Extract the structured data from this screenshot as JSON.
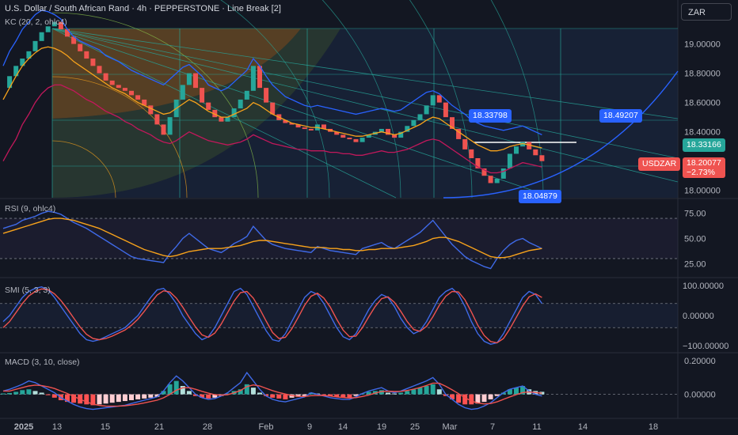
{
  "header": {
    "title": "U.S. Dollar / South African Rand · 4h · PEPPERSTONE · Line Break [2]",
    "kc_label": "KC (20, 2, ohlc4)",
    "currency_button": "ZAR"
  },
  "indicators": {
    "rsi_label": "RSI (9, ohlc4)",
    "smi_label": "SMI (5, 3, 3)",
    "macd_label": "MACD (3, 10, close)"
  },
  "price_tags": {
    "upper_channel": "18.49207",
    "green_level": "18.33166",
    "symbol": "USDZAR",
    "last_price": "18.20077",
    "change": "−2.73%",
    "box_upper": "18.33798",
    "box_lower": "18.04879"
  },
  "colors": {
    "background": "#131722",
    "up": "#26a69a",
    "down": "#ef5350",
    "kc_upper": "#2962ff",
    "kc_basis": "#f7a21b",
    "kc_lower": "#c2185b",
    "rsi": "#3f6ae8",
    "rsi_ma": "#f7a21b",
    "smi": "#3f6ae8",
    "smi_signal": "#ef5350",
    "macd": "#3f6ae8",
    "macd_signal": "#ef5350"
  },
  "chart_data": [
    {
      "type": "line",
      "pane": "price",
      "ylim": [
        17.95,
        19.3
      ],
      "y_ticks": [
        19.0,
        18.8,
        18.6,
        18.4,
        18.0
      ],
      "y_tick_labels": [
        "19.00000",
        "18.80000",
        "18.60000",
        "18.40000",
        "18.00000"
      ],
      "x_ticks": [
        "2025",
        "13",
        "15",
        "21",
        "28",
        "Feb",
        "9",
        "14",
        "19",
        "25",
        "Mar",
        "7",
        "11",
        "14",
        "18"
      ],
      "grid": true,
      "series": [
        {
          "role": "price",
          "values": [
            18.7,
            18.78,
            18.85,
            18.9,
            18.95,
            19.02,
            19.08,
            19.12,
            19.15,
            19.1,
            19.05,
            19.0,
            18.95,
            18.9,
            18.85,
            18.8,
            18.75,
            18.72,
            18.7,
            18.68,
            18.65,
            18.62,
            18.58,
            18.52,
            18.45,
            18.38,
            18.5,
            18.62,
            18.72,
            18.8,
            18.7,
            18.6,
            18.55,
            18.5,
            18.47,
            18.5,
            18.56,
            18.62,
            18.68,
            18.85,
            18.7,
            18.6,
            18.52,
            18.48,
            18.46,
            18.45,
            18.43,
            18.42,
            18.41,
            18.45,
            18.42,
            18.4,
            18.38,
            18.36,
            18.35,
            18.33,
            18.36,
            18.38,
            18.4,
            18.42,
            18.38,
            18.36,
            18.4,
            18.44,
            18.48,
            18.52,
            18.58,
            18.65,
            18.6,
            18.5,
            18.42,
            18.35,
            18.28,
            18.22,
            18.15,
            18.1,
            18.05,
            18.08,
            18.15,
            18.25,
            18.3,
            18.33,
            18.28,
            18.24,
            18.2
          ]
        },
        {
          "role": "kc_upper",
          "values": [
            18.85,
            18.95,
            19.02,
            19.1,
            19.15,
            19.2,
            19.23,
            19.22,
            19.2,
            19.17,
            19.1,
            19.05,
            19.02,
            19.0,
            18.98,
            18.96,
            18.92,
            18.9,
            18.88,
            18.85,
            18.82,
            18.8,
            18.78,
            18.76,
            18.74,
            18.72,
            18.76,
            18.8,
            18.84,
            18.86,
            18.82,
            18.78,
            18.72,
            18.7,
            18.68,
            18.7,
            18.74,
            18.78,
            18.82,
            18.9,
            18.85,
            18.78,
            18.72,
            18.68,
            18.64,
            18.62,
            18.6,
            18.58,
            18.57,
            18.58,
            18.57,
            18.56,
            18.55,
            18.54,
            18.53,
            18.52,
            18.53,
            18.54,
            18.55,
            18.56,
            18.55,
            18.54,
            18.55,
            18.58,
            18.61,
            18.64,
            18.67,
            18.68,
            18.66,
            18.62,
            18.58,
            18.55,
            18.52,
            18.48,
            18.46,
            18.44,
            18.43,
            18.42,
            18.41,
            18.42,
            18.43,
            18.44,
            18.42,
            18.4,
            18.38
          ]
        },
        {
          "role": "kc_basis",
          "values": [
            18.62,
            18.7,
            18.78,
            18.85,
            18.9,
            18.94,
            18.97,
            18.98,
            18.97,
            18.95,
            18.92,
            18.88,
            18.85,
            18.82,
            18.79,
            18.76,
            18.73,
            18.7,
            18.68,
            18.66,
            18.63,
            18.6,
            18.58,
            18.56,
            18.54,
            18.52,
            18.53,
            18.56,
            18.59,
            18.62,
            18.6,
            18.57,
            18.54,
            18.52,
            18.5,
            18.5,
            18.52,
            18.54,
            18.56,
            18.6,
            18.58,
            18.55,
            18.52,
            18.5,
            18.48,
            18.46,
            18.45,
            18.44,
            18.43,
            18.43,
            18.42,
            18.41,
            18.4,
            18.39,
            18.38,
            18.37,
            18.37,
            18.38,
            18.39,
            18.4,
            18.39,
            18.38,
            18.39,
            18.41,
            18.43,
            18.45,
            18.48,
            18.5,
            18.49,
            18.46,
            18.43,
            18.4,
            18.37,
            18.34,
            18.31,
            18.29,
            18.27,
            18.27,
            18.28,
            18.3,
            18.31,
            18.32,
            18.31,
            18.3,
            18.29
          ]
        },
        {
          "role": "kc_lower",
          "values": [
            18.2,
            18.28,
            18.35,
            18.45,
            18.52,
            18.6,
            18.66,
            18.7,
            18.72,
            18.72,
            18.7,
            18.68,
            18.65,
            18.62,
            18.6,
            18.57,
            18.54,
            18.52,
            18.5,
            18.47,
            18.45,
            18.42,
            18.4,
            18.38,
            18.35,
            18.33,
            18.32,
            18.34,
            18.37,
            18.4,
            18.38,
            18.36,
            18.34,
            18.33,
            18.32,
            18.31,
            18.32,
            18.33,
            18.35,
            18.38,
            18.36,
            18.34,
            18.32,
            18.31,
            18.3,
            18.29,
            18.28,
            18.28,
            18.27,
            18.27,
            18.27,
            18.26,
            18.26,
            18.25,
            18.25,
            18.24,
            18.24,
            18.25,
            18.26,
            18.27,
            18.26,
            18.26,
            18.27,
            18.28,
            18.3,
            18.32,
            18.34,
            18.35,
            18.34,
            18.31,
            18.28,
            18.25,
            18.22,
            18.19,
            18.16,
            18.14,
            18.12,
            18.12,
            18.13,
            18.15,
            18.17,
            18.19,
            18.18,
            18.17,
            18.16
          ]
        }
      ]
    },
    {
      "type": "line",
      "pane": "rsi",
      "ylim": [
        15,
        85
      ],
      "y_tick_labels": [
        "75.00",
        "50.00",
        "25.00"
      ],
      "bands": [
        70,
        30
      ],
      "series": [
        {
          "role": "rsi",
          "values": [
            60,
            62,
            64,
            68,
            70,
            72,
            75,
            77,
            76,
            74,
            70,
            66,
            63,
            60,
            56,
            52,
            48,
            44,
            40,
            36,
            32,
            30,
            29,
            28,
            27,
            26,
            35,
            42,
            50,
            55,
            50,
            45,
            40,
            38,
            36,
            40,
            45,
            48,
            52,
            62,
            55,
            48,
            44,
            42,
            40,
            39,
            38,
            37,
            36,
            42,
            40,
            38,
            37,
            36,
            35,
            34,
            40,
            42,
            44,
            46,
            42,
            40,
            44,
            48,
            52,
            56,
            62,
            68,
            60,
            52,
            44,
            38,
            32,
            28,
            25,
            22,
            20,
            30,
            38,
            44,
            48,
            50,
            46,
            43,
            40
          ]
        },
        {
          "role": "rsi_ma",
          "values": [
            55,
            57,
            59,
            61,
            63,
            65,
            67,
            69,
            70,
            70,
            69,
            68,
            66,
            64,
            62,
            60,
            57,
            54,
            51,
            48,
            45,
            42,
            39,
            37,
            35,
            33,
            32,
            33,
            35,
            37,
            38,
            39,
            40,
            40,
            40,
            41,
            42,
            43,
            45,
            47,
            48,
            48,
            47,
            46,
            45,
            44,
            43,
            42,
            41,
            41,
            41,
            40,
            40,
            39,
            39,
            38,
            38,
            39,
            39,
            40,
            40,
            40,
            41,
            42,
            43,
            45,
            47,
            50,
            51,
            51,
            49,
            47,
            44,
            41,
            38,
            35,
            32,
            31,
            31,
            32,
            34,
            36,
            38,
            39,
            40
          ]
        }
      ]
    },
    {
      "type": "line",
      "pane": "smi",
      "ylim": [
        -110,
        110
      ],
      "y_tick_labels": [
        "100.00000",
        "0.00000",
        "−100.00000"
      ],
      "bands": [
        40,
        -40
      ],
      "series": [
        {
          "role": "smi",
          "values": [
            -20,
            0,
            30,
            60,
            80,
            90,
            95,
            85,
            60,
            30,
            0,
            -30,
            -60,
            -80,
            -85,
            -80,
            -70,
            -60,
            -50,
            -40,
            -20,
            0,
            30,
            60,
            85,
            90,
            70,
            40,
            0,
            -30,
            -60,
            -80,
            -70,
            -40,
            0,
            40,
            80,
            90,
            70,
            30,
            -10,
            -50,
            -80,
            -85,
            -60,
            -20,
            20,
            60,
            80,
            70,
            40,
            0,
            -40,
            -70,
            -80,
            -60,
            -20,
            20,
            50,
            70,
            60,
            30,
            -10,
            -40,
            -60,
            -50,
            -20,
            20,
            60,
            80,
            90,
            70,
            30,
            -20,
            -60,
            -85,
            -95,
            -90,
            -60,
            -20,
            20,
            60,
            80,
            70,
            40
          ]
        },
        {
          "role": "smi_signal",
          "values": [
            -40,
            -20,
            10,
            40,
            65,
            80,
            88,
            86,
            72,
            50,
            22,
            -8,
            -38,
            -62,
            -76,
            -80,
            -76,
            -68,
            -58,
            -48,
            -32,
            -12,
            14,
            42,
            68,
            82,
            78,
            58,
            28,
            -6,
            -38,
            -64,
            -72,
            -58,
            -28,
            10,
            48,
            76,
            80,
            58,
            22,
            -18,
            -56,
            -76,
            -72,
            -44,
            -6,
            34,
            64,
            74,
            58,
            28,
            -12,
            -48,
            -70,
            -68,
            -40,
            -4,
            30,
            56,
            62,
            44,
            14,
            -20,
            -46,
            -52,
            -36,
            -4,
            34,
            64,
            80,
            78,
            52,
            12,
            -32,
            -66,
            -86,
            -90,
            -76,
            -44,
            -6,
            32,
            62,
            72,
            60
          ]
        }
      ]
    },
    {
      "type": "bar",
      "pane": "macd",
      "ylim": [
        -0.12,
        0.22
      ],
      "y_tick_labels": [
        "0.20000",
        "0.00000"
      ],
      "series": [
        {
          "role": "histogram",
          "values": [
            0.005,
            0.008,
            0.015,
            0.025,
            0.03,
            0.02,
            0.01,
            -0.005,
            -0.02,
            -0.035,
            -0.045,
            -0.05,
            -0.055,
            -0.06,
            -0.065,
            -0.06,
            -0.055,
            -0.05,
            -0.045,
            -0.04,
            -0.035,
            -0.03,
            -0.025,
            -0.02,
            -0.015,
            0.02,
            0.06,
            0.08,
            0.05,
            0.02,
            -0.01,
            -0.02,
            -0.025,
            -0.02,
            -0.01,
            0.005,
            0.02,
            0.03,
            0.06,
            0.04,
            0.01,
            -0.01,
            -0.02,
            -0.025,
            -0.03,
            -0.02,
            -0.015,
            -0.01,
            0.01,
            0.005,
            -0.005,
            -0.01,
            -0.015,
            -0.02,
            -0.02,
            -0.01,
            0.005,
            0.015,
            0.02,
            0.025,
            0.01,
            0.005,
            0.01,
            0.02,
            0.03,
            0.04,
            0.05,
            0.06,
            0.03,
            -0.01,
            -0.03,
            -0.05,
            -0.06,
            -0.06,
            -0.055,
            -0.045,
            -0.03,
            -0.01,
            0.01,
            0.03,
            0.04,
            0.05,
            0.03,
            0.02,
            0.015
          ]
        },
        {
          "role": "macd",
          "values": [
            0.02,
            0.03,
            0.045,
            0.06,
            0.08,
            0.07,
            0.05,
            0.03,
            0.01,
            -0.02,
            -0.04,
            -0.06,
            -0.075,
            -0.085,
            -0.09,
            -0.085,
            -0.08,
            -0.075,
            -0.07,
            -0.065,
            -0.055,
            -0.045,
            -0.035,
            -0.025,
            -0.015,
            0.02,
            0.07,
            0.11,
            0.08,
            0.04,
            0.0,
            -0.02,
            -0.03,
            -0.025,
            -0.01,
            0.01,
            0.04,
            0.07,
            0.13,
            0.08,
            0.03,
            -0.01,
            -0.03,
            -0.04,
            -0.045,
            -0.035,
            -0.025,
            -0.015,
            0.01,
            0.0,
            -0.01,
            -0.02,
            -0.025,
            -0.03,
            -0.03,
            -0.015,
            0.005,
            0.02,
            0.03,
            0.04,
            0.02,
            0.01,
            0.02,
            0.035,
            0.05,
            0.065,
            0.08,
            0.1,
            0.06,
            0.0,
            -0.03,
            -0.06,
            -0.08,
            -0.09,
            -0.085,
            -0.07,
            -0.05,
            -0.02,
            0.01,
            0.03,
            0.04,
            0.05,
            0.02,
            0.0,
            -0.01
          ]
        },
        {
          "role": "macd_signal",
          "values": [
            0.02,
            0.02,
            0.03,
            0.04,
            0.05,
            0.055,
            0.052,
            0.045,
            0.035,
            0.02,
            0.005,
            -0.012,
            -0.03,
            -0.045,
            -0.058,
            -0.066,
            -0.07,
            -0.071,
            -0.07,
            -0.068,
            -0.064,
            -0.058,
            -0.051,
            -0.043,
            -0.035,
            -0.021,
            0.0,
            0.025,
            0.039,
            0.04,
            0.03,
            0.018,
            0.007,
            -0.002,
            -0.005,
            -0.002,
            0.009,
            0.023,
            0.046,
            0.056,
            0.05,
            0.036,
            0.022,
            0.011,
            0.002,
            -0.007,
            -0.012,
            -0.013,
            -0.008,
            -0.006,
            -0.007,
            -0.01,
            -0.015,
            -0.019,
            -0.022,
            -0.02,
            -0.013,
            -0.004,
            0.007,
            0.017,
            0.019,
            0.017,
            0.018,
            0.023,
            0.031,
            0.041,
            0.053,
            0.067,
            0.066,
            0.048,
            0.027,
            0.004,
            -0.02,
            -0.04,
            -0.052,
            -0.057,
            -0.055,
            -0.045,
            -0.03,
            -0.015,
            -0.002,
            0.011,
            0.014,
            0.011,
            0.007
          ]
        }
      ]
    }
  ]
}
